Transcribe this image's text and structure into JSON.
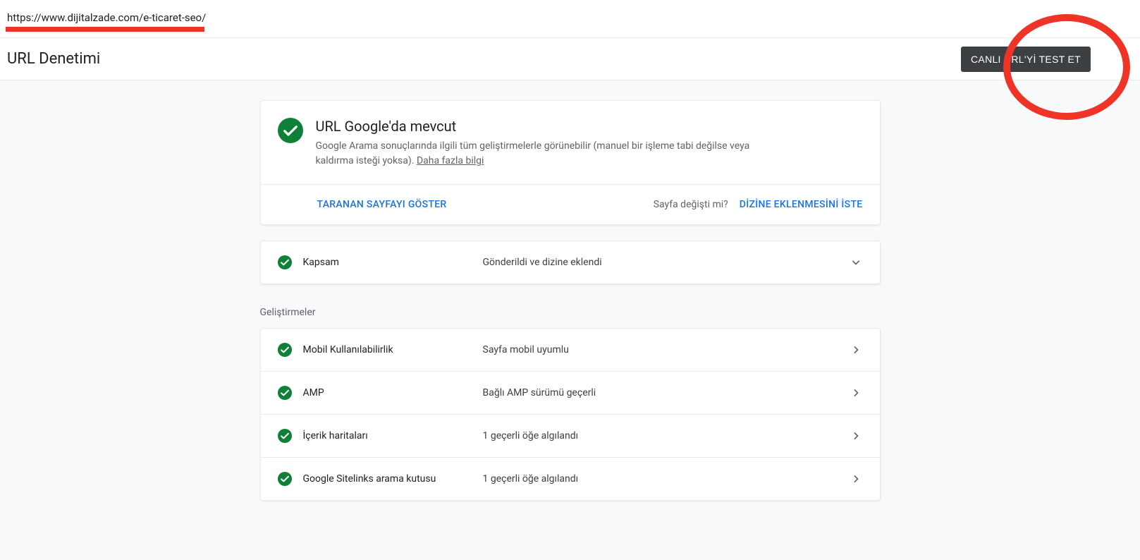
{
  "topbar": {
    "url": "https://www.dijitalzade.com/e-ticaret-seo/"
  },
  "header": {
    "title": "URL Denetimi",
    "test_live_button": "CANLI URL'Yİ TEST ET"
  },
  "status": {
    "title": "URL Google'da mevcut",
    "description": "Google Arama sonuçlarında ilgili tüm geliştirmelerle görünebilir (manuel bir işleme tabi değilse veya kaldırma isteği yoksa). ",
    "learn_more": "Daha fazla bilgi"
  },
  "actions": {
    "view_crawled": "TARANAN SAYFAYI GÖSTER",
    "page_changed": "Sayfa değişti mi?",
    "request_indexing": "DİZİNE EKLENMESİNİ İSTE"
  },
  "coverage": {
    "label": "Kapsam",
    "value": "Gönderildi ve dizine eklendi"
  },
  "enhancements_label": "Geliştirmeler",
  "enhancements": [
    {
      "label": "Mobil Kullanılabilirlik",
      "value": "Sayfa mobil uyumlu"
    },
    {
      "label": "AMP",
      "value": "Bağlı AMP sürümü geçerli"
    },
    {
      "label": "İçerik haritaları",
      "value": "1 geçerli öğe algılandı"
    },
    {
      "label": "Google Sitelinks arama kutusu",
      "value": "1 geçerli öğe algılandı"
    }
  ]
}
